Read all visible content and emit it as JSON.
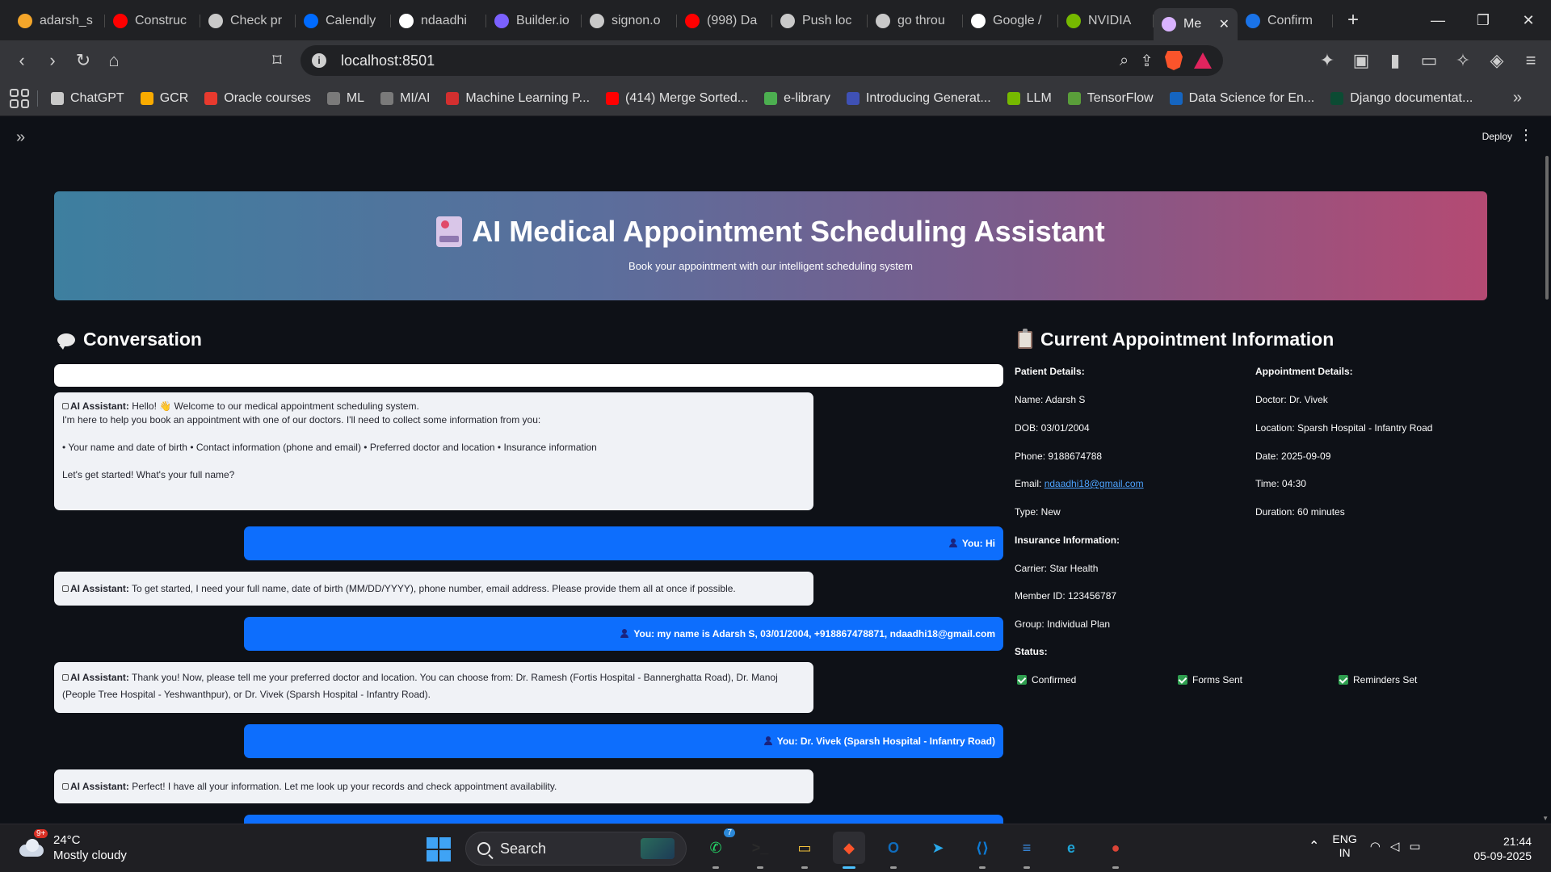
{
  "browser": {
    "tabs": [
      {
        "title": "adarsh_s",
        "favicon": "#f4a62a",
        "icon": "person-icon"
      },
      {
        "title": "Construc",
        "favicon": "#ff0000",
        "icon": "youtube-icon"
      },
      {
        "title": "Check pr",
        "favicon": "#c9c9c9",
        "icon": "openai-icon"
      },
      {
        "title": "Calendly",
        "favicon": "#006bff",
        "icon": "calendly-icon"
      },
      {
        "title": "ndaadhi",
        "favicon": "#ffffff",
        "icon": "github-icon"
      },
      {
        "title": "Builder.io",
        "favicon": "#7b61ff",
        "icon": "builder-icon"
      },
      {
        "title": "signon.o",
        "favicon": "#c9c9c9",
        "icon": "link-icon"
      },
      {
        "title": "(998) Da",
        "favicon": "#ff0000",
        "icon": "youtube-icon"
      },
      {
        "title": "Push loc",
        "favicon": "#c9c9c9",
        "icon": "openai-icon"
      },
      {
        "title": "go throu",
        "favicon": "#c9c9c9",
        "icon": "grok-icon"
      },
      {
        "title": "Google /",
        "favicon": "#ffffff",
        "icon": "google-icon"
      },
      {
        "title": "NVIDIA",
        "favicon": "#76b900",
        "icon": "nvidia-icon"
      },
      {
        "title": "Me",
        "favicon": "#d9b3ff",
        "icon": "streamlit-page-icon",
        "active": true
      },
      {
        "title": "Confirm",
        "favicon": "#1a73e8",
        "icon": "calendly-icon"
      }
    ],
    "url": "localhost:8501",
    "bookmarks": [
      {
        "label": "ChatGPT",
        "color": "#c9c9c9"
      },
      {
        "label": "GCR",
        "color": "#f9ab00"
      },
      {
        "label": "Oracle courses",
        "color": "#e83a2e"
      },
      {
        "label": "ML",
        "color": "#7a7a7a"
      },
      {
        "label": "MI/AI",
        "color": "#7a7a7a"
      },
      {
        "label": "Machine Learning P...",
        "color": "#d32f2f"
      },
      {
        "label": "(414) Merge Sorted...",
        "color": "#ff0000"
      },
      {
        "label": "e-library",
        "color": "#4caf50"
      },
      {
        "label": "Introducing Generat...",
        "color": "#3f51b5"
      },
      {
        "label": "LLM",
        "color": "#76b900"
      },
      {
        "label": "TensorFlow",
        "color": "#5a9e3a"
      },
      {
        "label": "Data Science for En...",
        "color": "#1565c0"
      },
      {
        "label": "Django documentat...",
        "color": "#0c4b33"
      }
    ],
    "bookmarks_more": "»"
  },
  "app": {
    "sidebar_toggle": "»",
    "deploy_label": "Deploy",
    "menu_glyph": "⋮",
    "header": {
      "title": "AI Medical Appointment Scheduling Assistant",
      "subtitle": "Book your appointment with our intelligent scheduling system"
    },
    "conversation": {
      "heading": "Conversation",
      "messages": [
        {
          "role": "assistant",
          "speaker": "AI Assistant:",
          "lines": [
            "Hello! 👋 Welcome to our medical appointment scheduling system.",
            "I'm here to help you book an appointment with one of our doctors. I'll need to collect some information from you:",
            "",
            "• Your name and date of birth • Contact information (phone and email) • Preferred doctor and location • Insurance information",
            "",
            "Let's get started! What's your full name?"
          ]
        },
        {
          "role": "user",
          "speaker": "You:",
          "text": "Hi"
        },
        {
          "role": "assistant",
          "speaker": "AI Assistant:",
          "lines": [
            "To get started, I need your full name, date of birth (MM/DD/YYYY), phone number, email address. Please provide them all at once if possible."
          ]
        },
        {
          "role": "user",
          "speaker": "You:",
          "text": "my name is Adarsh S, 03/01/2004, +918867478871, ndaadhi18@gmail.com"
        },
        {
          "role": "assistant",
          "speaker": "AI Assistant:",
          "lines": [
            "Thank you! Now, please tell me your preferred doctor and location. You can choose from: Dr. Ramesh (Fortis Hospital - Bannerghatta Road), Dr. Manoj",
            "(People Tree Hospital - Yeshwanthpur), or Dr. Vivek (Sparsh Hospital - Infantry Road)."
          ]
        },
        {
          "role": "user",
          "speaker": "You:",
          "text": "Dr. Vivek (Sparsh Hospital - Infantry Road)"
        },
        {
          "role": "assistant",
          "speaker": "AI Assistant:",
          "lines": [
            "Perfect! I have all your information. Let me look up your records and check appointment availability."
          ]
        }
      ]
    },
    "appointment": {
      "heading": "Current Appointment Information",
      "patient_heading": "Patient Details:",
      "name": "Name: Adarsh S",
      "dob": "DOB: 03/01/2004",
      "phone": "Phone: 9188674788",
      "email_label": "Email: ",
      "email": "ndaadhi18@gmail.com",
      "type": "Type: New",
      "insurance_heading": "Insurance Information:",
      "carrier": "Carrier: Star Health",
      "member_id": "Member ID: 123456787",
      "group": "Group: Individual Plan",
      "status_heading": "Status:",
      "status_items": [
        "Confirmed",
        "Forms Sent",
        "Reminders Set"
      ],
      "details_heading": "Appointment Details:",
      "doctor": "Doctor: Dr. Vivek",
      "location": "Location: Sparsh Hospital - Infantry Road",
      "date": "Date: 2025-09-09",
      "time": "Time: 04:30",
      "duration": "Duration: 60 minutes"
    }
  },
  "taskbar": {
    "weather_temp": "24°C",
    "weather_desc": "Mostly cloudy",
    "weather_badge": "9+",
    "search_label": "Search",
    "apps": [
      {
        "name": "whatsapp",
        "color": "#25d366",
        "glyph": "✆",
        "badge": "7"
      },
      {
        "name": "terminal",
        "color": "#2b2b2b",
        "glyph": ">_"
      },
      {
        "name": "file-explorer",
        "color": "#f2c13b",
        "glyph": "▭"
      },
      {
        "name": "brave",
        "color": "#fb542b",
        "glyph": "◆"
      },
      {
        "name": "outlook",
        "color": "#0f6cbd",
        "glyph": "O"
      },
      {
        "name": "telegram",
        "color": "#29a9eb",
        "glyph": "➤"
      },
      {
        "name": "vscode",
        "color": "#0e7ad3",
        "glyph": "⟨⟩"
      },
      {
        "name": "notepad",
        "color": "#3a8ee6",
        "glyph": "≡"
      },
      {
        "name": "edge",
        "color": "#1fa4d6",
        "glyph": "e"
      },
      {
        "name": "chrome",
        "color": "#db4437",
        "glyph": "●"
      }
    ],
    "lang_top": "ENG",
    "lang_bottom": "IN",
    "time": "21:44",
    "date": "05-09-2025"
  }
}
